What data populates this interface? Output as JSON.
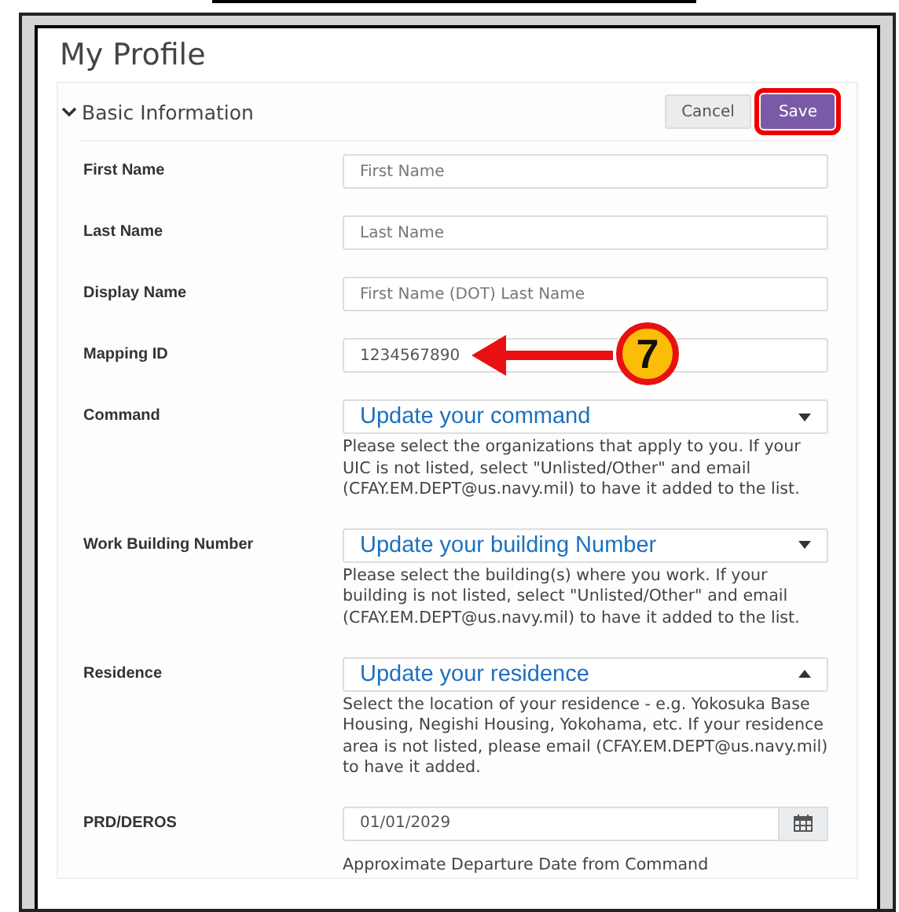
{
  "page": {
    "title": "My Profile"
  },
  "section": {
    "title": "Basic Information",
    "expanded": true,
    "buttons": [
      {
        "label": "Cancel",
        "kind": "secondary",
        "highlighted": false
      },
      {
        "label": "Save",
        "kind": "primary",
        "highlighted": true
      }
    ]
  },
  "fields": [
    {
      "label": "First Name",
      "kind": "text",
      "placeholder": "First Name"
    },
    {
      "label": "Last Name",
      "kind": "text",
      "placeholder": "Last Name"
    },
    {
      "label": "Display Name",
      "kind": "text",
      "placeholder": "First Name (DOT) Last Name"
    },
    {
      "label": "Mapping ID",
      "kind": "text",
      "value": "1234567890",
      "callout": {
        "number": "7"
      }
    },
    {
      "label": "Command",
      "kind": "select",
      "value": "Update your command",
      "expanded": false,
      "help": "Please select the organizations that apply to you. If your UIC is not listed, select \"Unlisted/Other\" and email (CFAY.EM.DEPT@us.navy.mil) to have it added to the list."
    },
    {
      "label": "Work Building Number",
      "kind": "select",
      "value": "Update your building Number",
      "expanded": false,
      "help": "Please select the building(s) where you work. If your building is not listed, select \"Unlisted/Other\" and email (CFAY.EM.DEPT@us.navy.mil) to have it added to the list."
    },
    {
      "label": "Residence",
      "kind": "select",
      "value": "Update your residence",
      "expanded": true,
      "help": "Select the location of your residence - e.g. Yokosuka Base Housing, Negishi Housing, Yokohama, etc. If your residence area is not listed, please email (CFAY.EM.DEPT@us.navy.mil) to have it added."
    },
    {
      "label": "PRD/DEROS",
      "kind": "date",
      "value": "01/01/2029",
      "help": "Approximate Departure Date from Command"
    }
  ]
}
